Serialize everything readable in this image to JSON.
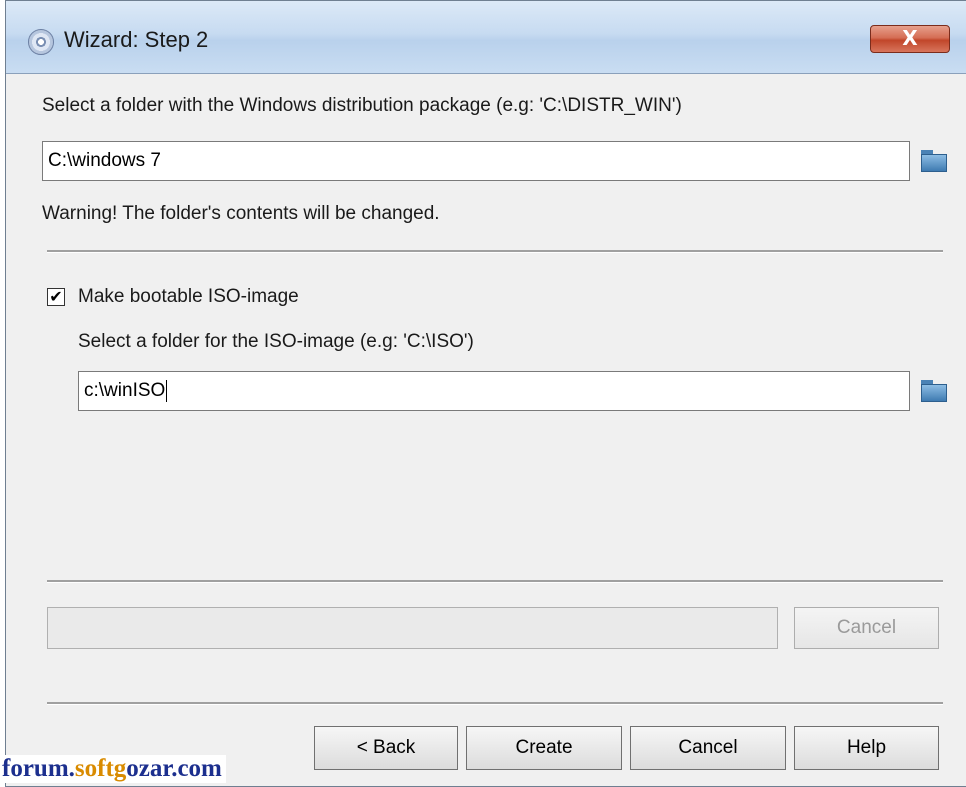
{
  "window": {
    "title": "Wizard: Step 2",
    "close_label": "X"
  },
  "distrib": {
    "prompt": "Select a folder with the Windows distribution package (e.g: 'C:\\DISTR_WIN')",
    "path_value": "C:\\windows 7",
    "warning": "Warning! The folder's contents will be changed."
  },
  "iso": {
    "checkbox_checked": true,
    "checkbox_mark": "✔",
    "checkbox_label": "Make bootable ISO-image",
    "prompt": "Select a folder for the ISO-image (e.g: 'C:\\ISO')",
    "path_value": "c:\\winISO"
  },
  "progress": {
    "value": 0,
    "cancel_label": "Cancel"
  },
  "buttons": {
    "back_label": "< Back",
    "create_label": "Create",
    "cancel_label": "Cancel",
    "help_label": "Help"
  },
  "watermark": {
    "part1": "forum.",
    "part2": "soft",
    "part3": "g",
    "part4": "ozar.com"
  }
}
